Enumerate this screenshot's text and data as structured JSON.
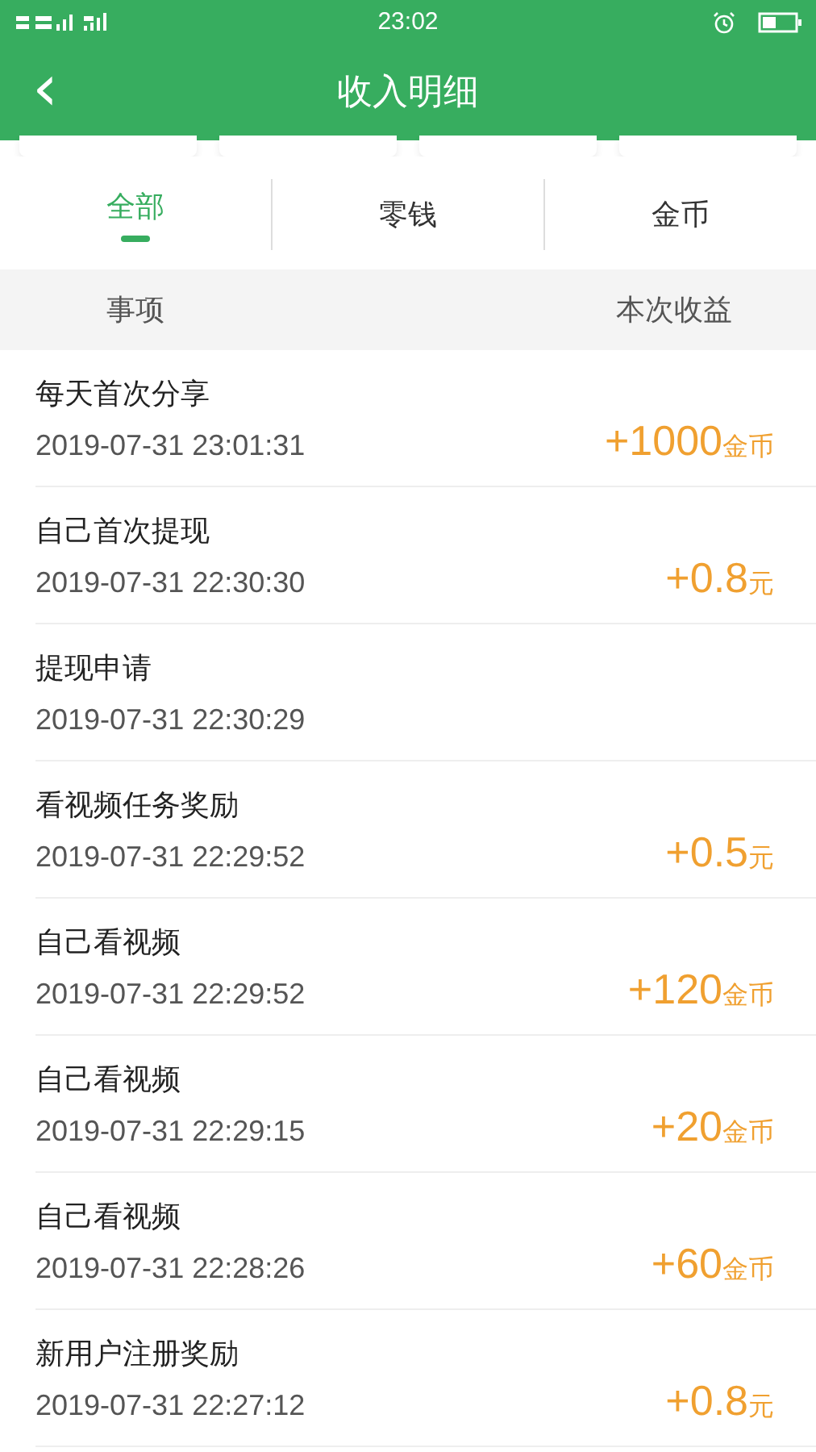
{
  "status_bar": {
    "time": "23:02"
  },
  "header": {
    "title": "收入明细",
    "back": "‹"
  },
  "tabs": [
    {
      "label": "全部",
      "selected": true
    },
    {
      "label": "零钱",
      "selected": false
    },
    {
      "label": "金币",
      "selected": false
    }
  ],
  "table": {
    "columns": [
      "事项",
      "本次收益"
    ],
    "rows": [
      {
        "title": "每天首次分享",
        "time": "2019-07-31 23:01:31",
        "amount": "+1000",
        "unit": "金币"
      },
      {
        "title": "自己首次提现",
        "time": "2019-07-31 22:30:30",
        "amount": "+0.8",
        "unit": "元"
      },
      {
        "title": "提现申请",
        "time": "2019-07-31 22:30:29"
      },
      {
        "title": "看视频任务奖励",
        "time": "2019-07-31 22:29:52",
        "amount": "+0.5",
        "unit": "元"
      },
      {
        "title": "自己看视频",
        "time": "2019-07-31 22:29:52",
        "amount": "+120",
        "unit": "金币"
      },
      {
        "title": "自己看视频",
        "time": "2019-07-31 22:29:15",
        "amount": "+20",
        "unit": "金币"
      },
      {
        "title": "自己看视频",
        "time": "2019-07-31 22:28:26",
        "amount": "+60",
        "unit": "金币"
      },
      {
        "title": "新用户注册奖励",
        "time": "2019-07-31 22:27:12",
        "amount": "+0.8",
        "unit": "元"
      }
    ]
  }
}
